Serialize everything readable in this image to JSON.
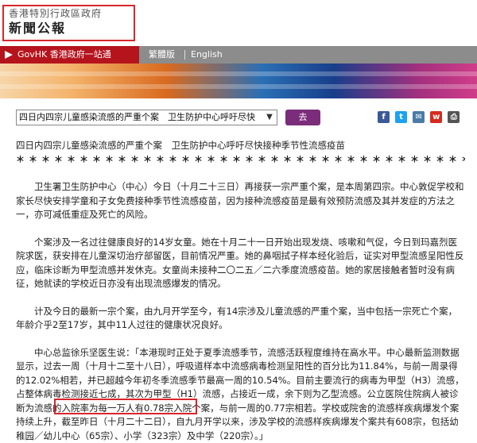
{
  "header": {
    "org_name": "香港特別行政區政府",
    "section_title": "新聞公報"
  },
  "nav": {
    "govhk": "GovHK 香港政府一站通",
    "traditional": "繁體版",
    "english": "English"
  },
  "toolbar": {
    "select_value": "四日内四宗儿童感染流感的严重个案　卫生防护中心呼吁尽快",
    "go_label": "去"
  },
  "share": {
    "icons": [
      "facebook-icon",
      "twitter-icon",
      "email-icon",
      "weibo-icon",
      "print-icon"
    ],
    "colors": {
      "facebook": "#3b5998",
      "twitter": "#1da1f2",
      "email": "#4a7ba6",
      "weibo": "#d52b1e",
      "print": "#555555"
    }
  },
  "article": {
    "title": "四日内四宗儿童感染流感的严重个案　卫生防护中心呼吁尽快接种季节性流感疫苗",
    "stars": "＊＊＊＊＊＊＊＊＊＊＊＊＊＊＊＊＊＊＊＊＊＊＊＊＊＊＊＊＊＊＊＊＊＊＊＊＊＊",
    "paragraphs": [
      "卫生署卫生防护中心（中心）今日（十月二十三日）再接获一宗严重个案，是本周第四宗。中心敦促学校和家长尽快安排学童和子女免费接种季节性流感疫苗，因为接种流感疫苗是最有效预防流感及其并发症的方法之一，亦可减低重症及死亡的风险。",
      "个案涉及一名过往健康良好的14岁女童。她在十月二十一日开始出现发烧、咳嗽和气促，今日到玛嘉烈医院求医，获安排在儿童深切治疗部留医，目前情况严重。她的鼻咽拭子样本经化验后，证实对甲型流感呈阳性反应，临床诊断为甲型流感并发休克。女童尚未接种二〇二五／二六季度流感疫苗。她的家居接触者暂时没有病征，她就读的学校近日亦没有出现流感爆发的情况。",
      "计及今日的最新一宗个案，由九月开学至今，有14宗涉及儿童流感的严重个案，当中包括一宗死亡个案，年龄介乎2至17岁，其中11人过往的健康状况良好。",
      "中心总监徐乐坚医生说：「本港现时正处于夏季流感季节，流感活跃程度维持在高水平。中心最新监测数据显示，过去一周（十月十二至十八日），呼吸道样本中流感病毒检测呈阳性的百分比为11.84%，与前一周录得的12.02%相若，并已超越今年初冬季流感季节最高一周的10.54%。目前主要流行的病毒为甲型（H3）流感，占整体病毒检测接近七成，其次为甲型（H1）流感，占接近一成，余下则为乙型流感。公立医院住院病人被诊断为流感的入院率为每一万人有0.78宗入院个案，与前一周的0.77宗相若。学校或院舍的流感样疾病爆发个案持续上升，截至昨日（十月二十二日），自九月开学以来，涉及学校的流感样疾病爆发个案共有608宗，包括幼稚园／幼儿中心（65宗）、小学（323宗）及中学（220宗）。」"
    ]
  }
}
